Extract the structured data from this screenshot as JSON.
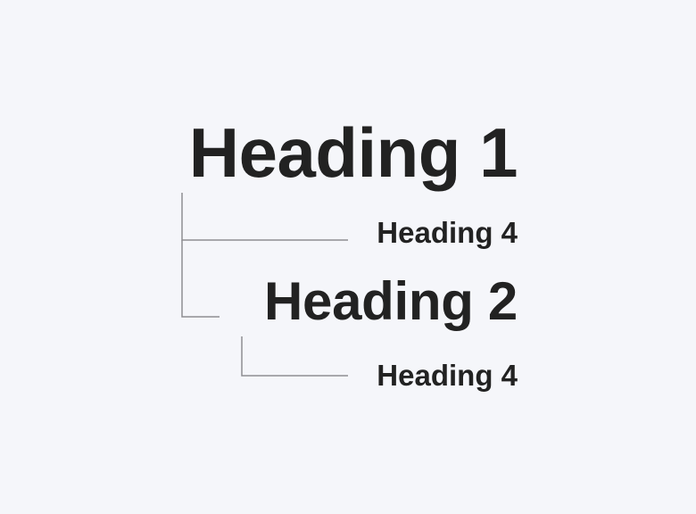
{
  "colors": {
    "background": "#f5f6fa",
    "text": "#222222",
    "connector": "#8e8e92"
  },
  "headings": {
    "heading_1": "Heading 1",
    "heading_4_first": "Heading 4",
    "heading_2": "Heading 2",
    "heading_4_second": "Heading 4"
  }
}
